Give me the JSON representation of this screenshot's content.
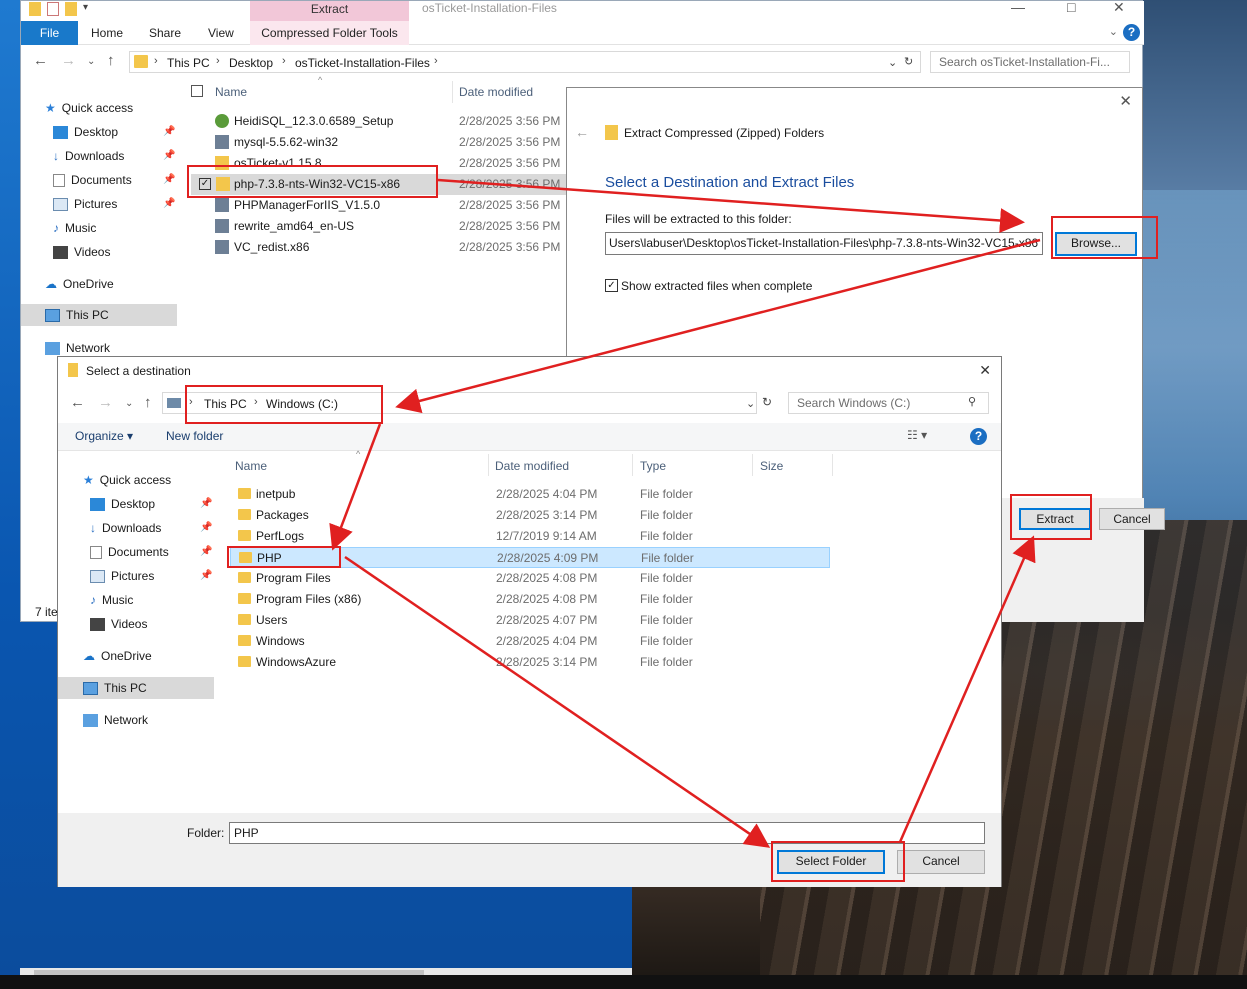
{
  "explorer": {
    "title": "osTicket-Installation-Files",
    "context_tab": "Extract",
    "ribbon_tabs": [
      "File",
      "Home",
      "Share",
      "View"
    ],
    "ribbon_context": "Compressed Folder Tools",
    "address": [
      "This PC",
      "Desktop",
      "osTicket-Installation-Files"
    ],
    "search_placeholder": "Search osTicket-Installation-Fi...",
    "nav": {
      "quick_access": "Quick access",
      "desktop": "Desktop",
      "downloads": "Downloads",
      "documents": "Documents",
      "pictures": "Pictures",
      "music": "Music",
      "videos": "Videos",
      "onedrive": "OneDrive",
      "this_pc": "This PC",
      "network": "Network"
    },
    "columns": {
      "name": "Name",
      "date": "Date modified"
    },
    "files": [
      {
        "name": "HeidiSQL_12.3.0.6589_Setup",
        "date": "2/28/2025 3:56 PM"
      },
      {
        "name": "mysql-5.5.62-win32",
        "date": "2/28/2025 3:56 PM"
      },
      {
        "name": "osTicket-v1.15.8",
        "date": "2/28/2025 3:56 PM"
      },
      {
        "name": "php-7.3.8-nts-Win32-VC15-x86",
        "date": "2/28/2025 3:56 PM"
      },
      {
        "name": "PHPManagerForIIS_V1.5.0",
        "date": "2/28/2025 3:56 PM"
      },
      {
        "name": "rewrite_amd64_en-US",
        "date": "2/28/2025 3:56 PM"
      },
      {
        "name": "VC_redist.x86",
        "date": "2/28/2025 3:56 PM"
      }
    ],
    "status": "7 ite"
  },
  "extract": {
    "title": "Extract Compressed (Zipped) Folders",
    "heading": "Select a Destination and Extract Files",
    "label": "Files will be extracted to this folder:",
    "path": "Users\\labuser\\Desktop\\osTicket-Installation-Files\\php-7.3.8-nts-Win32-VC15-x86",
    "browse": "Browse...",
    "checkbox_label": "Show extracted files when complete",
    "extract_btn": "Extract",
    "cancel_btn": "Cancel"
  },
  "seldest": {
    "title": "Select a destination",
    "address": [
      "This PC",
      "Windows (C:)"
    ],
    "search_placeholder": "Search Windows (C:)",
    "organize": "Organize ▾",
    "new_folder": "New folder",
    "nav": {
      "quick_access": "Quick access",
      "desktop": "Desktop",
      "downloads": "Downloads",
      "documents": "Documents",
      "pictures": "Pictures",
      "music": "Music",
      "videos": "Videos",
      "onedrive": "OneDrive",
      "this_pc": "This PC",
      "network": "Network"
    },
    "columns": {
      "name": "Name",
      "date": "Date modified",
      "type": "Type",
      "size": "Size"
    },
    "folders": [
      {
        "name": "inetpub",
        "date": "2/28/2025 4:04 PM",
        "type": "File folder"
      },
      {
        "name": "Packages",
        "date": "2/28/2025 3:14 PM",
        "type": "File folder"
      },
      {
        "name": "PerfLogs",
        "date": "12/7/2019 9:14 AM",
        "type": "File folder"
      },
      {
        "name": "PHP",
        "date": "2/28/2025 4:09 PM",
        "type": "File folder"
      },
      {
        "name": "Program Files",
        "date": "2/28/2025 4:08 PM",
        "type": "File folder"
      },
      {
        "name": "Program Files (x86)",
        "date": "2/28/2025 4:08 PM",
        "type": "File folder"
      },
      {
        "name": "Users",
        "date": "2/28/2025 4:07 PM",
        "type": "File folder"
      },
      {
        "name": "Windows",
        "date": "2/28/2025 4:04 PM",
        "type": "File folder"
      },
      {
        "name": "WindowsAzure",
        "date": "2/28/2025 3:14 PM",
        "type": "File folder"
      }
    ],
    "folder_label": "Folder:",
    "folder_value": "PHP",
    "select_btn": "Select Folder",
    "cancel_btn": "Cancel"
  },
  "colors": {
    "accent": "#0078d7",
    "annotation": "#e02020",
    "file_tab": "#1979ca",
    "selection": "#cce8ff"
  }
}
